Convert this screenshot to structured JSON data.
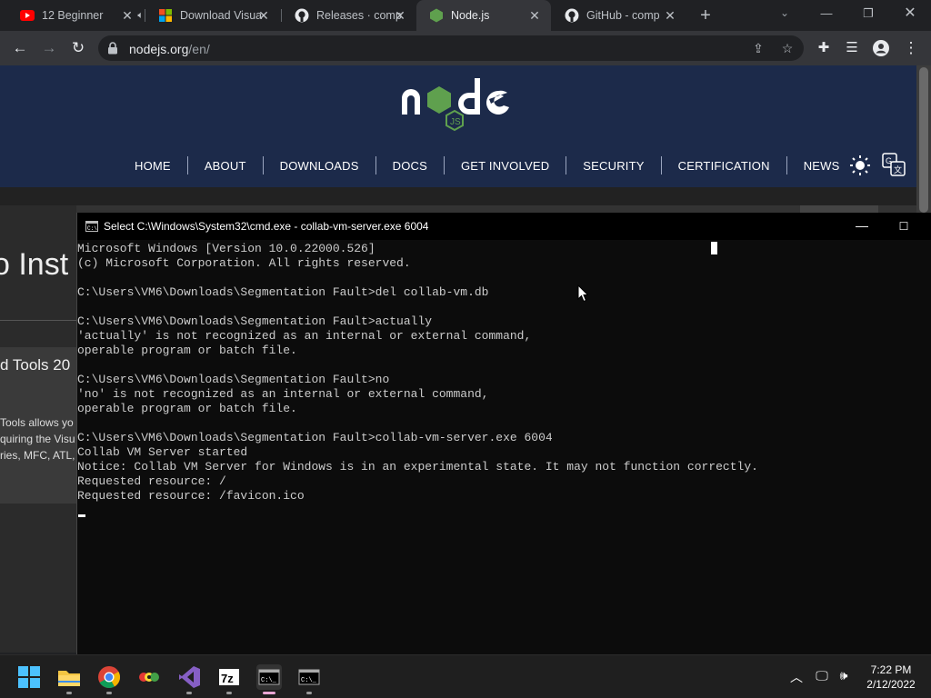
{
  "browser": {
    "tabs": [
      {
        "title": "12 Beginner",
        "favicon": "youtube-icon",
        "active": false
      },
      {
        "title": "Download Visua",
        "favicon": "microsoft-icon",
        "active": false
      },
      {
        "title": "Releases · comp",
        "favicon": "github-icon",
        "active": false
      },
      {
        "title": "Node.js",
        "favicon": "nodejs-icon",
        "active": true
      },
      {
        "title": "GitHub - comp",
        "favicon": "github-icon",
        "active": false
      }
    ],
    "new_tab": "+",
    "url_host": "nodejs.org",
    "url_path": "/en/"
  },
  "site": {
    "nav": [
      "HOME",
      "ABOUT",
      "DOWNLOADS",
      "DOCS",
      "GET INVOLVED",
      "SECURITY",
      "CERTIFICATION",
      "NEWS"
    ],
    "left_title": "o Inst",
    "left_subtitle": "d Tools 20",
    "left_para": [
      "Tools allows yo",
      "quiring the Visu",
      "ries, MFC, ATL,"
    ]
  },
  "cmd": {
    "title": "Select C:\\Windows\\System32\\cmd.exe - collab-vm-server.exe  6004",
    "lines": [
      "Microsoft Windows [Version 10.0.22000.526]",
      "(c) Microsoft Corporation. All rights reserved.",
      "",
      "C:\\Users\\VM6\\Downloads\\Segmentation Fault>del collab-vm.db",
      "",
      "C:\\Users\\VM6\\Downloads\\Segmentation Fault>actually",
      "'actually' is not recognized as an internal or external command,",
      "operable program or batch file.",
      "",
      "C:\\Users\\VM6\\Downloads\\Segmentation Fault>no",
      "'no' is not recognized as an internal or external command,",
      "operable program or batch file.",
      "",
      "C:\\Users\\VM6\\Downloads\\Segmentation Fault>collab-vm-server.exe 6004",
      "Collab VM Server started",
      "Notice: Collab VM Server for Windows is in an experimental state. It may not function correctly.",
      "Requested resource: /",
      "Requested resource: /favicon.ico"
    ]
  },
  "taskbar": {
    "apps": [
      "start-icon",
      "file-explorer-icon",
      "chrome-icon",
      "app-icon",
      "visual-studio-icon",
      "7zip-icon",
      "cmd-icon",
      "cmd-icon"
    ],
    "time": "7:22 PM",
    "date": "2/12/2022"
  },
  "colors": {
    "node_header": "#1c2a4a",
    "node_green": "#43853d",
    "browser_frame": "#202124",
    "cmd_bg": "#0c0c0c"
  }
}
